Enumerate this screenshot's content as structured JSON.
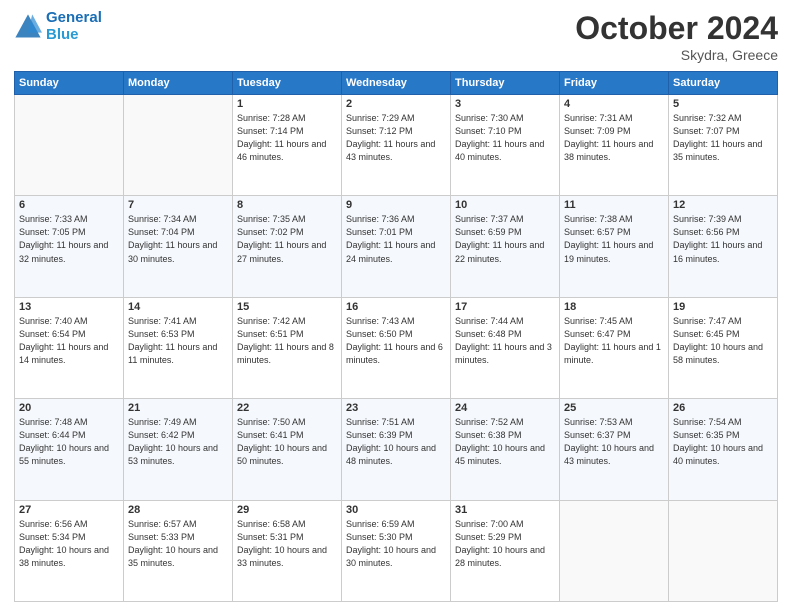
{
  "header": {
    "logo_line1": "General",
    "logo_line2": "Blue",
    "month": "October 2024",
    "location": "Skydra, Greece"
  },
  "weekdays": [
    "Sunday",
    "Monday",
    "Tuesday",
    "Wednesday",
    "Thursday",
    "Friday",
    "Saturday"
  ],
  "weeks": [
    [
      {
        "day": "",
        "info": ""
      },
      {
        "day": "",
        "info": ""
      },
      {
        "day": "1",
        "info": "Sunrise: 7:28 AM\nSunset: 7:14 PM\nDaylight: 11 hours and 46 minutes."
      },
      {
        "day": "2",
        "info": "Sunrise: 7:29 AM\nSunset: 7:12 PM\nDaylight: 11 hours and 43 minutes."
      },
      {
        "day": "3",
        "info": "Sunrise: 7:30 AM\nSunset: 7:10 PM\nDaylight: 11 hours and 40 minutes."
      },
      {
        "day": "4",
        "info": "Sunrise: 7:31 AM\nSunset: 7:09 PM\nDaylight: 11 hours and 38 minutes."
      },
      {
        "day": "5",
        "info": "Sunrise: 7:32 AM\nSunset: 7:07 PM\nDaylight: 11 hours and 35 minutes."
      }
    ],
    [
      {
        "day": "6",
        "info": "Sunrise: 7:33 AM\nSunset: 7:05 PM\nDaylight: 11 hours and 32 minutes."
      },
      {
        "day": "7",
        "info": "Sunrise: 7:34 AM\nSunset: 7:04 PM\nDaylight: 11 hours and 30 minutes."
      },
      {
        "day": "8",
        "info": "Sunrise: 7:35 AM\nSunset: 7:02 PM\nDaylight: 11 hours and 27 minutes."
      },
      {
        "day": "9",
        "info": "Sunrise: 7:36 AM\nSunset: 7:01 PM\nDaylight: 11 hours and 24 minutes."
      },
      {
        "day": "10",
        "info": "Sunrise: 7:37 AM\nSunset: 6:59 PM\nDaylight: 11 hours and 22 minutes."
      },
      {
        "day": "11",
        "info": "Sunrise: 7:38 AM\nSunset: 6:57 PM\nDaylight: 11 hours and 19 minutes."
      },
      {
        "day": "12",
        "info": "Sunrise: 7:39 AM\nSunset: 6:56 PM\nDaylight: 11 hours and 16 minutes."
      }
    ],
    [
      {
        "day": "13",
        "info": "Sunrise: 7:40 AM\nSunset: 6:54 PM\nDaylight: 11 hours and 14 minutes."
      },
      {
        "day": "14",
        "info": "Sunrise: 7:41 AM\nSunset: 6:53 PM\nDaylight: 11 hours and 11 minutes."
      },
      {
        "day": "15",
        "info": "Sunrise: 7:42 AM\nSunset: 6:51 PM\nDaylight: 11 hours and 8 minutes."
      },
      {
        "day": "16",
        "info": "Sunrise: 7:43 AM\nSunset: 6:50 PM\nDaylight: 11 hours and 6 minutes."
      },
      {
        "day": "17",
        "info": "Sunrise: 7:44 AM\nSunset: 6:48 PM\nDaylight: 11 hours and 3 minutes."
      },
      {
        "day": "18",
        "info": "Sunrise: 7:45 AM\nSunset: 6:47 PM\nDaylight: 11 hours and 1 minute."
      },
      {
        "day": "19",
        "info": "Sunrise: 7:47 AM\nSunset: 6:45 PM\nDaylight: 10 hours and 58 minutes."
      }
    ],
    [
      {
        "day": "20",
        "info": "Sunrise: 7:48 AM\nSunset: 6:44 PM\nDaylight: 10 hours and 55 minutes."
      },
      {
        "day": "21",
        "info": "Sunrise: 7:49 AM\nSunset: 6:42 PM\nDaylight: 10 hours and 53 minutes."
      },
      {
        "day": "22",
        "info": "Sunrise: 7:50 AM\nSunset: 6:41 PM\nDaylight: 10 hours and 50 minutes."
      },
      {
        "day": "23",
        "info": "Sunrise: 7:51 AM\nSunset: 6:39 PM\nDaylight: 10 hours and 48 minutes."
      },
      {
        "day": "24",
        "info": "Sunrise: 7:52 AM\nSunset: 6:38 PM\nDaylight: 10 hours and 45 minutes."
      },
      {
        "day": "25",
        "info": "Sunrise: 7:53 AM\nSunset: 6:37 PM\nDaylight: 10 hours and 43 minutes."
      },
      {
        "day": "26",
        "info": "Sunrise: 7:54 AM\nSunset: 6:35 PM\nDaylight: 10 hours and 40 minutes."
      }
    ],
    [
      {
        "day": "27",
        "info": "Sunrise: 6:56 AM\nSunset: 5:34 PM\nDaylight: 10 hours and 38 minutes."
      },
      {
        "day": "28",
        "info": "Sunrise: 6:57 AM\nSunset: 5:33 PM\nDaylight: 10 hours and 35 minutes."
      },
      {
        "day": "29",
        "info": "Sunrise: 6:58 AM\nSunset: 5:31 PM\nDaylight: 10 hours and 33 minutes."
      },
      {
        "day": "30",
        "info": "Sunrise: 6:59 AM\nSunset: 5:30 PM\nDaylight: 10 hours and 30 minutes."
      },
      {
        "day": "31",
        "info": "Sunrise: 7:00 AM\nSunset: 5:29 PM\nDaylight: 10 hours and 28 minutes."
      },
      {
        "day": "",
        "info": ""
      },
      {
        "day": "",
        "info": ""
      }
    ]
  ]
}
